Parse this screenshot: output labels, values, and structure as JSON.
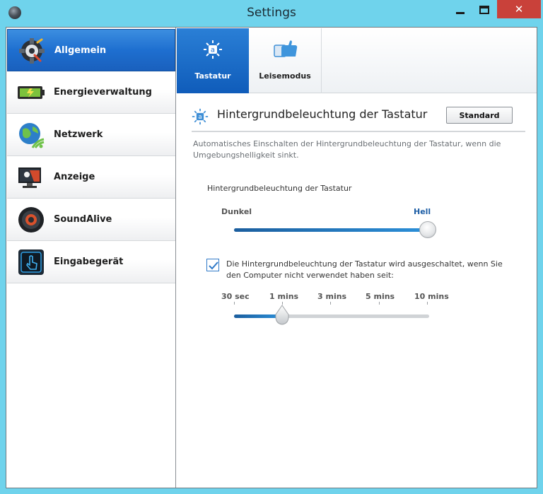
{
  "window": {
    "title": "Settings",
    "close_glyph": "✕"
  },
  "sidebar": {
    "items": [
      {
        "label": "Allgemein",
        "icon": "settings-gear-icon",
        "active": true
      },
      {
        "label": "Energieverwaltung",
        "icon": "battery-icon",
        "active": false
      },
      {
        "label": "Netzwerk",
        "icon": "globe-network-icon",
        "active": false
      },
      {
        "label": "Anzeige",
        "icon": "display-brightness-icon",
        "active": false
      },
      {
        "label": "SoundAlive",
        "icon": "speaker-icon",
        "active": false
      },
      {
        "label": "Eingabegerät",
        "icon": "touch-input-icon",
        "active": false
      }
    ]
  },
  "tabs": [
    {
      "label": "Tastatur",
      "icon": "keyboard-backlight-icon",
      "active": true
    },
    {
      "label": "Leisemodus",
      "icon": "silent-mode-hand-icon",
      "active": false
    }
  ],
  "section": {
    "title": "Hintergrundbeleuchtung der Tastatur",
    "standard_button": "Standard",
    "description": "Automatisches Einschalten der Hintergrundbeleuchtung der Tastatur, wenn die Umgebungshelligkeit sinkt."
  },
  "brightness": {
    "label": "Hintergrundbeleuchtung der Tastatur",
    "min_label": "Dunkel",
    "max_label": "Hell",
    "value_fraction": 1.0
  },
  "timeout": {
    "checked": true,
    "text": "Die Hintergrundbeleuchtung der Tastatur wird ausgeschaltet, wenn Sie den Computer nicht verwendet haben seit:",
    "options": [
      "30 sec",
      "1 mins",
      "3 mins",
      "5 mins",
      "10 mins"
    ],
    "selected_index": 1
  },
  "colors": {
    "accent": "#1e6fd0",
    "titlebar": "#6fd3ec",
    "close": "#c9413a"
  }
}
